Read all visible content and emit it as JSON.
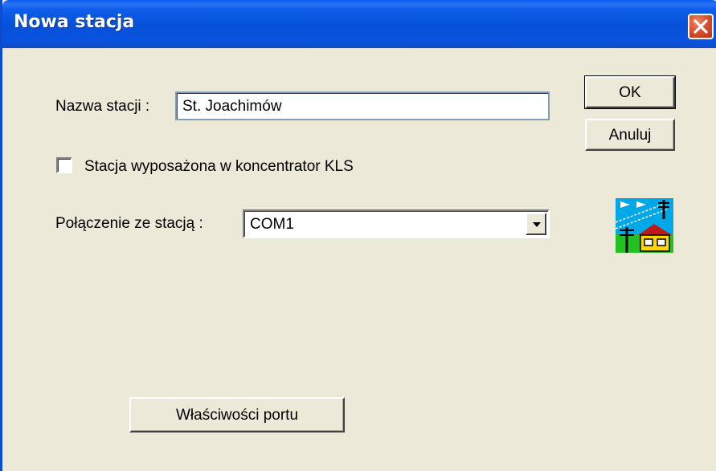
{
  "window": {
    "title": "Nowa stacja"
  },
  "form": {
    "station_name_label": "Nazwa stacji :",
    "station_name_value": "St. Joachimów",
    "kls_checkbox_label": "Stacja wyposażona w koncentrator KLS",
    "kls_checked": false,
    "connection_label": "Połączenie ze stacją :",
    "connection_value": "COM1"
  },
  "buttons": {
    "ok": "OK",
    "cancel": "Anuluj",
    "port_properties": "Właściwości portu"
  },
  "icons": {
    "close": "close-icon",
    "dropdown": "chevron-down-icon",
    "station": "station-icon"
  },
  "colors": {
    "titlebar": "#0a53e0",
    "dialog_bg": "#ece9d8",
    "close_button": "#d8522e"
  }
}
